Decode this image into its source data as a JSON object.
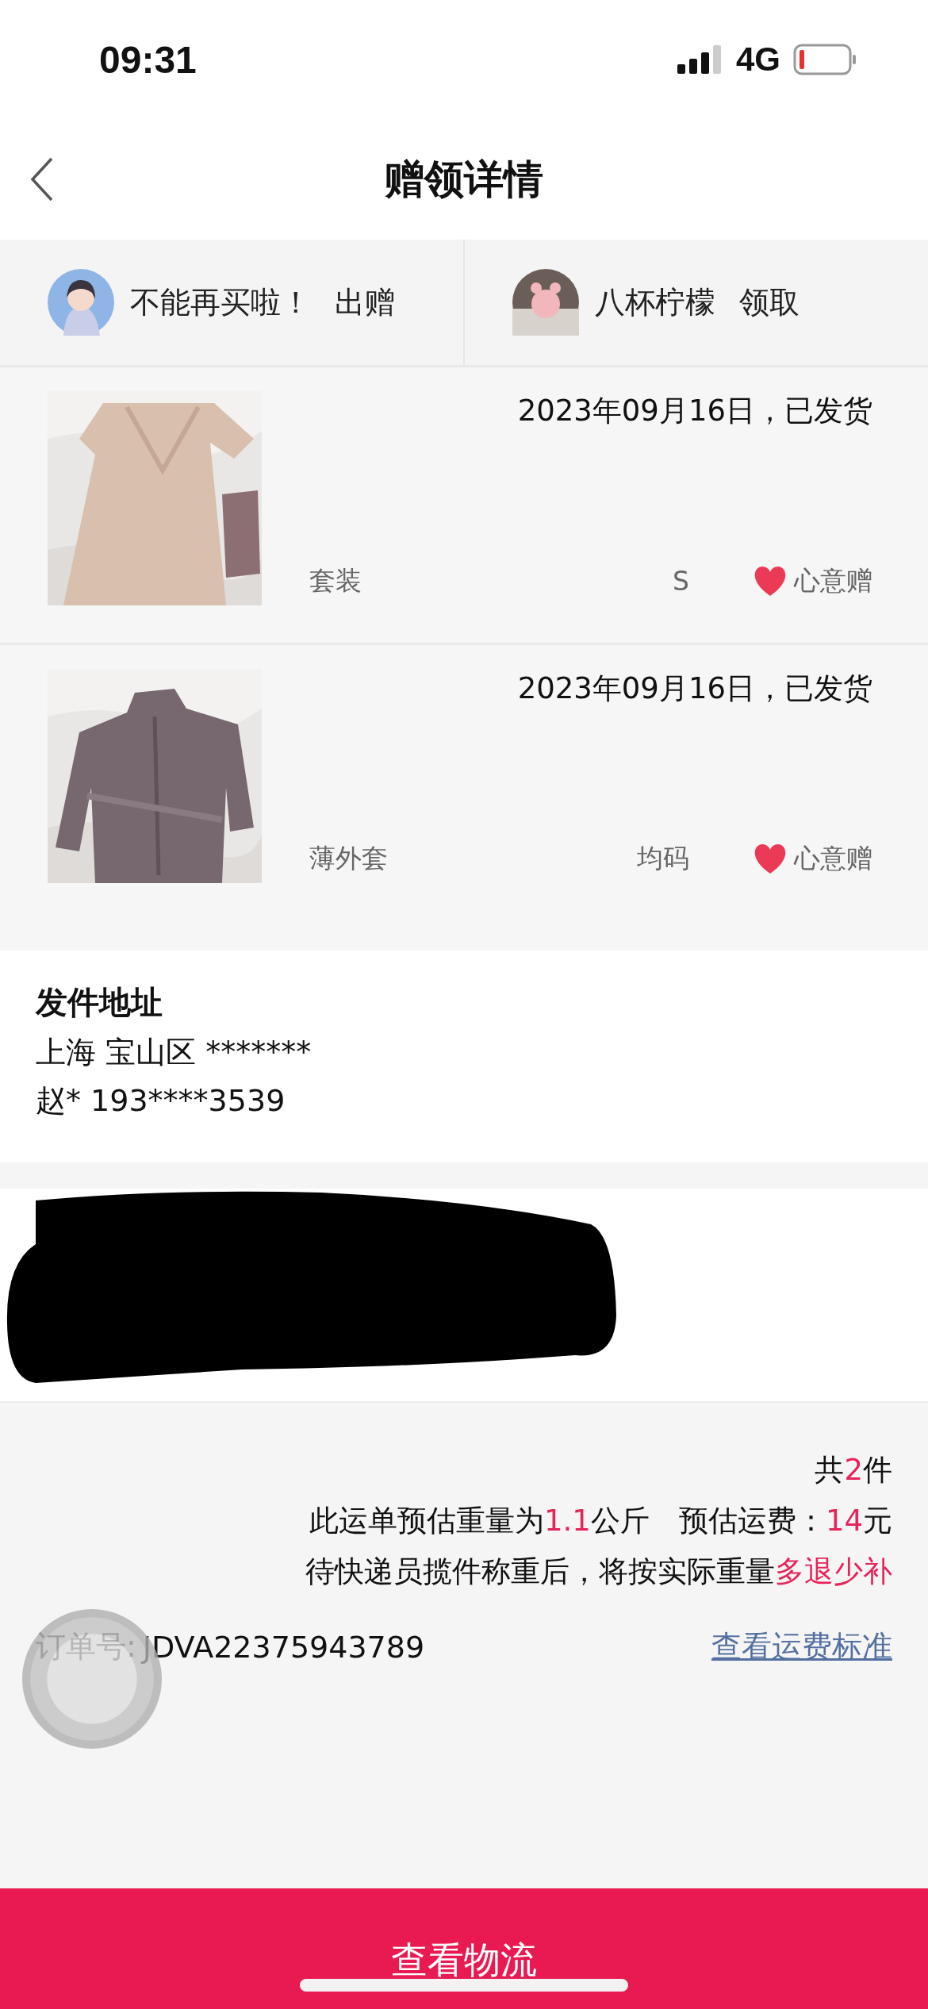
{
  "status_bar": {
    "time": "09:31",
    "network": "4G"
  },
  "header": {
    "title": "赠领详情"
  },
  "parties": [
    {
      "name": "不能再买啦！",
      "role": "出赠"
    },
    {
      "name": "八杯柠檬",
      "role": "领取"
    }
  ],
  "items": [
    {
      "date_status": "2023年09月16日，已发货",
      "category": "套装",
      "size": "S",
      "tag": "心意赠"
    },
    {
      "date_status": "2023年09月16日，已发货",
      "category": "薄外套",
      "size": "均码",
      "tag": "心意赠"
    }
  ],
  "sender": {
    "title": "发件地址",
    "address": "上海 宝山区 *******",
    "contact": "赵* 193****3539"
  },
  "receiver": {
    "redacted": true
  },
  "summary": {
    "lines": [
      [
        {
          "text": "共",
          "highlight": false
        },
        {
          "text": "2",
          "highlight": true
        },
        {
          "text": "件",
          "highlight": false
        }
      ],
      [
        {
          "text": "此运单预估重量为",
          "highlight": false
        },
        {
          "text": "1.1",
          "highlight": true
        },
        {
          "text": "公斤　预估运费：",
          "highlight": false
        },
        {
          "text": "14",
          "highlight": true
        },
        {
          "text": "元",
          "highlight": false
        }
      ],
      [
        {
          "text": "待快递员揽件称重后，将按实际重量",
          "highlight": false
        },
        {
          "text": "多退少补",
          "highlight": true
        }
      ]
    ],
    "order_label": "订单号:",
    "order_number": "JDVA22375943789",
    "fee_link": "查看运费标准"
  },
  "bottom_button": "查看物流"
}
